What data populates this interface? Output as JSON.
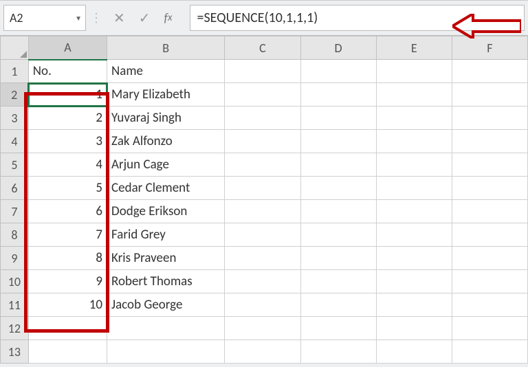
{
  "nameBox": "A2",
  "formula": "=SEQUENCE(10,1,1,1)",
  "columns": [
    "A",
    "B",
    "C",
    "D",
    "E",
    "F"
  ],
  "rows": [
    {
      "num": "1",
      "A": "No.",
      "B": "Name"
    },
    {
      "num": "2",
      "A": "1",
      "B": "Mary Elizabeth"
    },
    {
      "num": "3",
      "A": "2",
      "B": "Yuvaraj Singh"
    },
    {
      "num": "4",
      "A": "3",
      "B": "Zak Alfonzo"
    },
    {
      "num": "5",
      "A": "4",
      "B": "Arjun Cage"
    },
    {
      "num": "6",
      "A": "5",
      "B": "Cedar Clement"
    },
    {
      "num": "7",
      "A": "6",
      "B": "Dodge Erikson"
    },
    {
      "num": "8",
      "A": "7",
      "B": "Farid Grey"
    },
    {
      "num": "9",
      "A": "8",
      "B": "Kris Praveen"
    },
    {
      "num": "10",
      "A": "9",
      "B": "Robert Thomas"
    },
    {
      "num": "11",
      "A": "10",
      "B": "Jacob George"
    },
    {
      "num": "12",
      "A": "",
      "B": ""
    },
    {
      "num": "13",
      "A": "",
      "B": ""
    }
  ],
  "selectedCell": {
    "row": "2",
    "col": "A"
  }
}
